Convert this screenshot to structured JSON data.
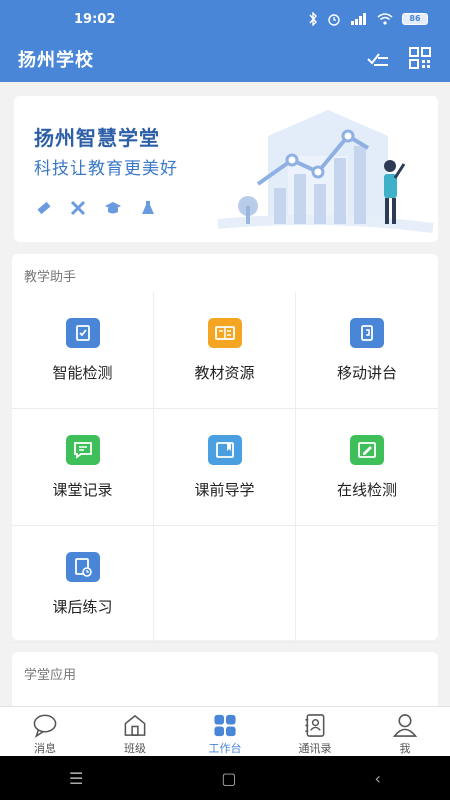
{
  "status_bar": {
    "time": "19:02",
    "battery": "86"
  },
  "header": {
    "title": "扬州学校"
  },
  "banner": {
    "title": "扬州智慧学堂",
    "subtitle": "科技让教育更美好"
  },
  "teaching": {
    "section_title": "教学助手",
    "items": [
      {
        "label": "智能检测",
        "icon": "smart-test-icon",
        "color": "#4a86d8"
      },
      {
        "label": "教材资源",
        "icon": "textbook-icon",
        "color": "#f4a623"
      },
      {
        "label": "移动讲台",
        "icon": "mobile-podium-icon",
        "color": "#4a86d8"
      },
      {
        "label": "课堂记录",
        "icon": "class-record-icon",
        "color": "#3fbf5a"
      },
      {
        "label": "课前导学",
        "icon": "pre-class-guide-icon",
        "color": "#4a9fe0"
      },
      {
        "label": "在线检测",
        "icon": "online-test-icon",
        "color": "#3fbf5a"
      },
      {
        "label": "课后练习",
        "icon": "homework-icon",
        "color": "#4a86d8"
      }
    ]
  },
  "study": {
    "section_title": "学堂应用"
  },
  "tabbar": {
    "items": [
      {
        "label": "消息",
        "icon": "message-icon"
      },
      {
        "label": "班级",
        "icon": "class-icon"
      },
      {
        "label": "工作台",
        "icon": "workbench-icon",
        "active": true
      },
      {
        "label": "通讯录",
        "icon": "contacts-icon"
      },
      {
        "label": "我",
        "icon": "profile-icon"
      }
    ]
  },
  "colors": {
    "primary": "#4a86d8",
    "active_tab": "#4a86d8"
  }
}
